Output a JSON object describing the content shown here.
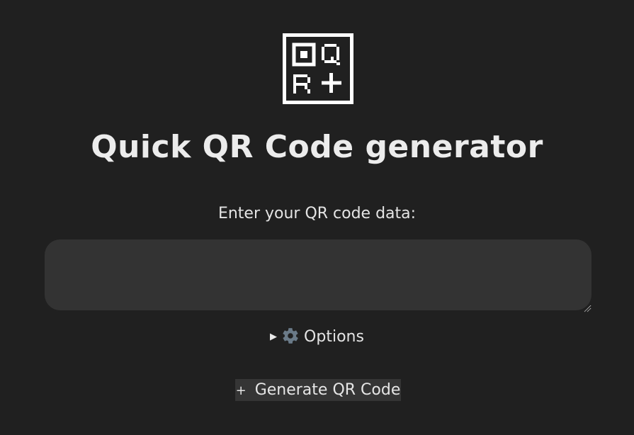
{
  "logo": {
    "icon": "qr-plus-logo-icon",
    "color": "#ffffff"
  },
  "header": {
    "title": "Quick QR Code generator"
  },
  "form": {
    "input_label": "Enter your QR code data:",
    "input_value": "",
    "input_placeholder": "",
    "options_label": "Options",
    "options_icon": "gear-icon",
    "options_expanded": false,
    "generate_label": "Generate QR Code",
    "generate_icon_glyph": "+"
  },
  "colors": {
    "background": "#202020",
    "input_background": "#333333",
    "button_background": "#353535",
    "text": "#e8e8e8",
    "gear": "#6a7a88"
  }
}
